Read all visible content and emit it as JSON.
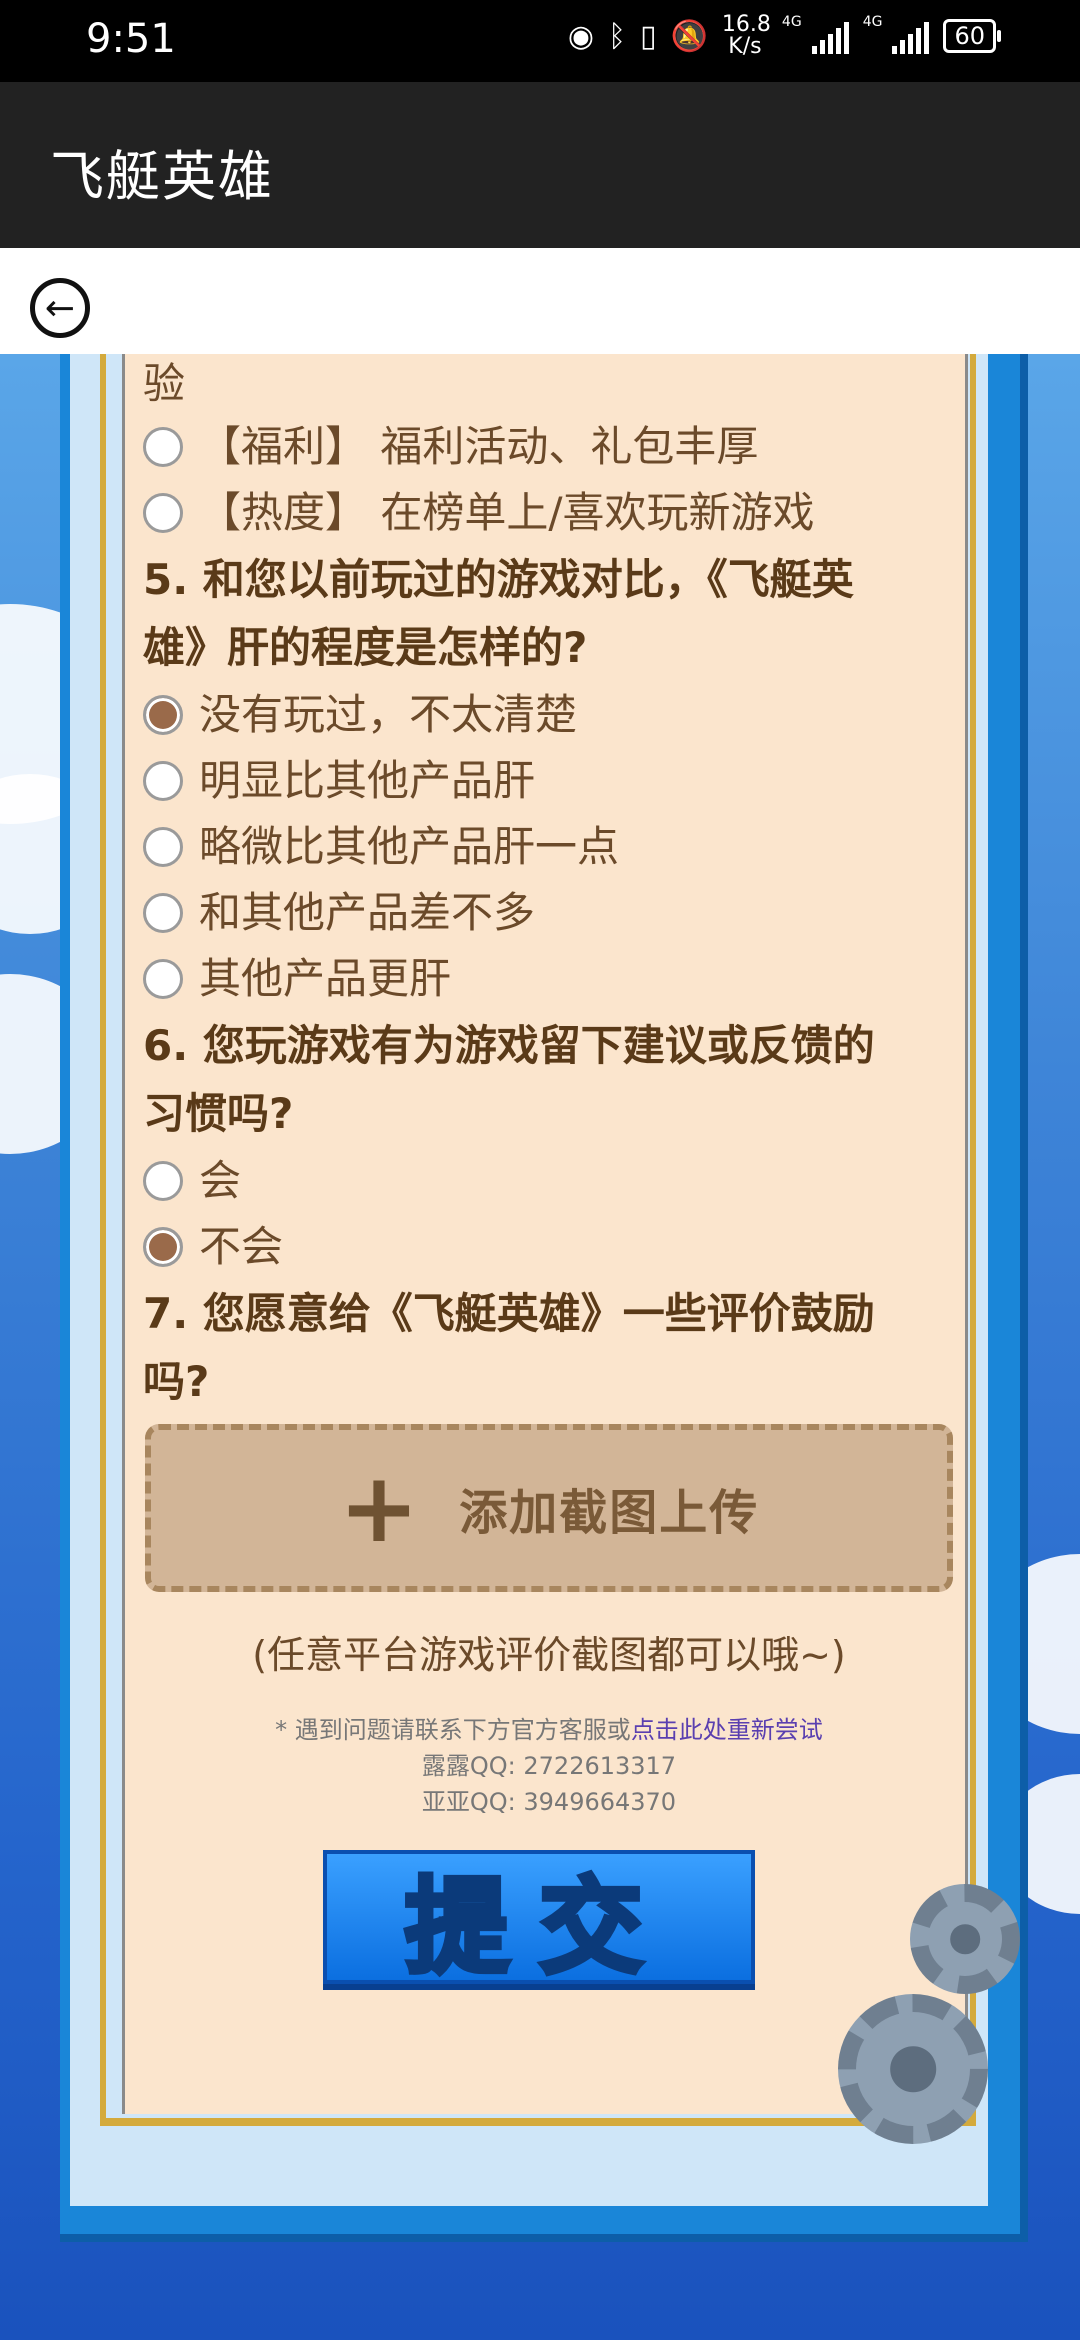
{
  "status_bar": {
    "time": "9:51",
    "speed_top": "16.8",
    "speed_bottom": "K/s",
    "net_a": "4G",
    "net_b": "4G",
    "battery": "60"
  },
  "app_bar": {
    "title": "飞艇英雄"
  },
  "survey": {
    "partial_top": "验",
    "q4_options": [
      "【福利】 福利活动、礼包丰厚",
      "【热度】 在榜单上/喜欢玩新游戏"
    ],
    "q5": {
      "title_line1": "5. 和您以前玩过的游戏对比，《飞艇英",
      "title_line2": "雄》肝的程度是怎样的?",
      "options": [
        "没有玩过，不太清楚",
        "明显比其他产品肝",
        "略微比其他产品肝一点",
        "和其他产品差不多",
        "其他产品更肝"
      ],
      "selected_index": 0
    },
    "q6": {
      "title_line1": "6. 您玩游戏有为游戏留下建议或反馈的",
      "title_line2": "习惯吗?",
      "options": [
        "会",
        "不会"
      ],
      "selected_index": 1
    },
    "q7": {
      "title_line1": "7. 您愿意给《飞艇英雄》一些评价鼓励",
      "title_line2": "吗?"
    },
    "upload_label": "添加截图上传",
    "hint": "(任意平台游戏评价截图都可以哦~)",
    "contact_prefix": "* 遇到问题请联系下方官方客服或",
    "contact_link": "点击此处重新尝试",
    "contact_qq1": "露露QQ:  2722613317",
    "contact_qq2": "亚亚QQ:  3949664370",
    "submit_label": "提交"
  },
  "colors": {
    "paper": "#fbe5cd",
    "text_brown": "#5a3a18",
    "submit_blue": "#0b6fe0",
    "link_purple": "#5a3fb0"
  }
}
